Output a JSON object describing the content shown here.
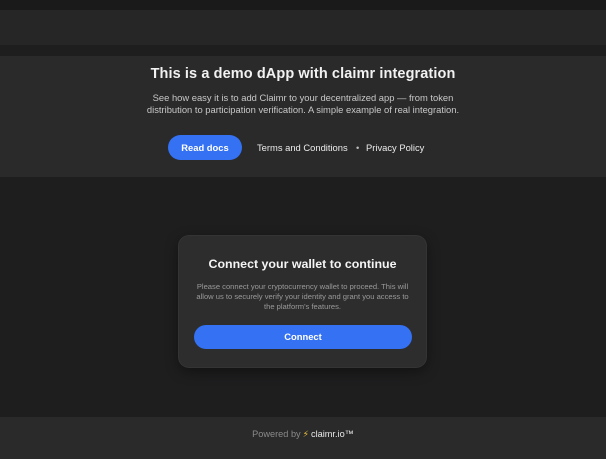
{
  "hero": {
    "title": "This is a demo dApp with claimr integration",
    "description": "See how easy it is to add Claimr to your decentralized app — from token distribution to participation verification. A simple example of real integration.",
    "read_docs_label": "Read docs",
    "terms_label": "Terms and Conditions",
    "separator": "•",
    "privacy_label": "Privacy Policy"
  },
  "card": {
    "title": "Connect your wallet to continue",
    "description": "Please connect your cryptocurrency wallet to proceed. This will allow us to securely verify your identity and grant you access to the platform's features.",
    "connect_label": "Connect"
  },
  "footer": {
    "powered_label": "Powered by",
    "bolt_icon": "⚡",
    "brand": "claimr.io™"
  },
  "colors": {
    "accent": "#3471f3",
    "background": "#1e1e1f",
    "panel": "#2a2a2b",
    "card": "#2d2d2e"
  }
}
